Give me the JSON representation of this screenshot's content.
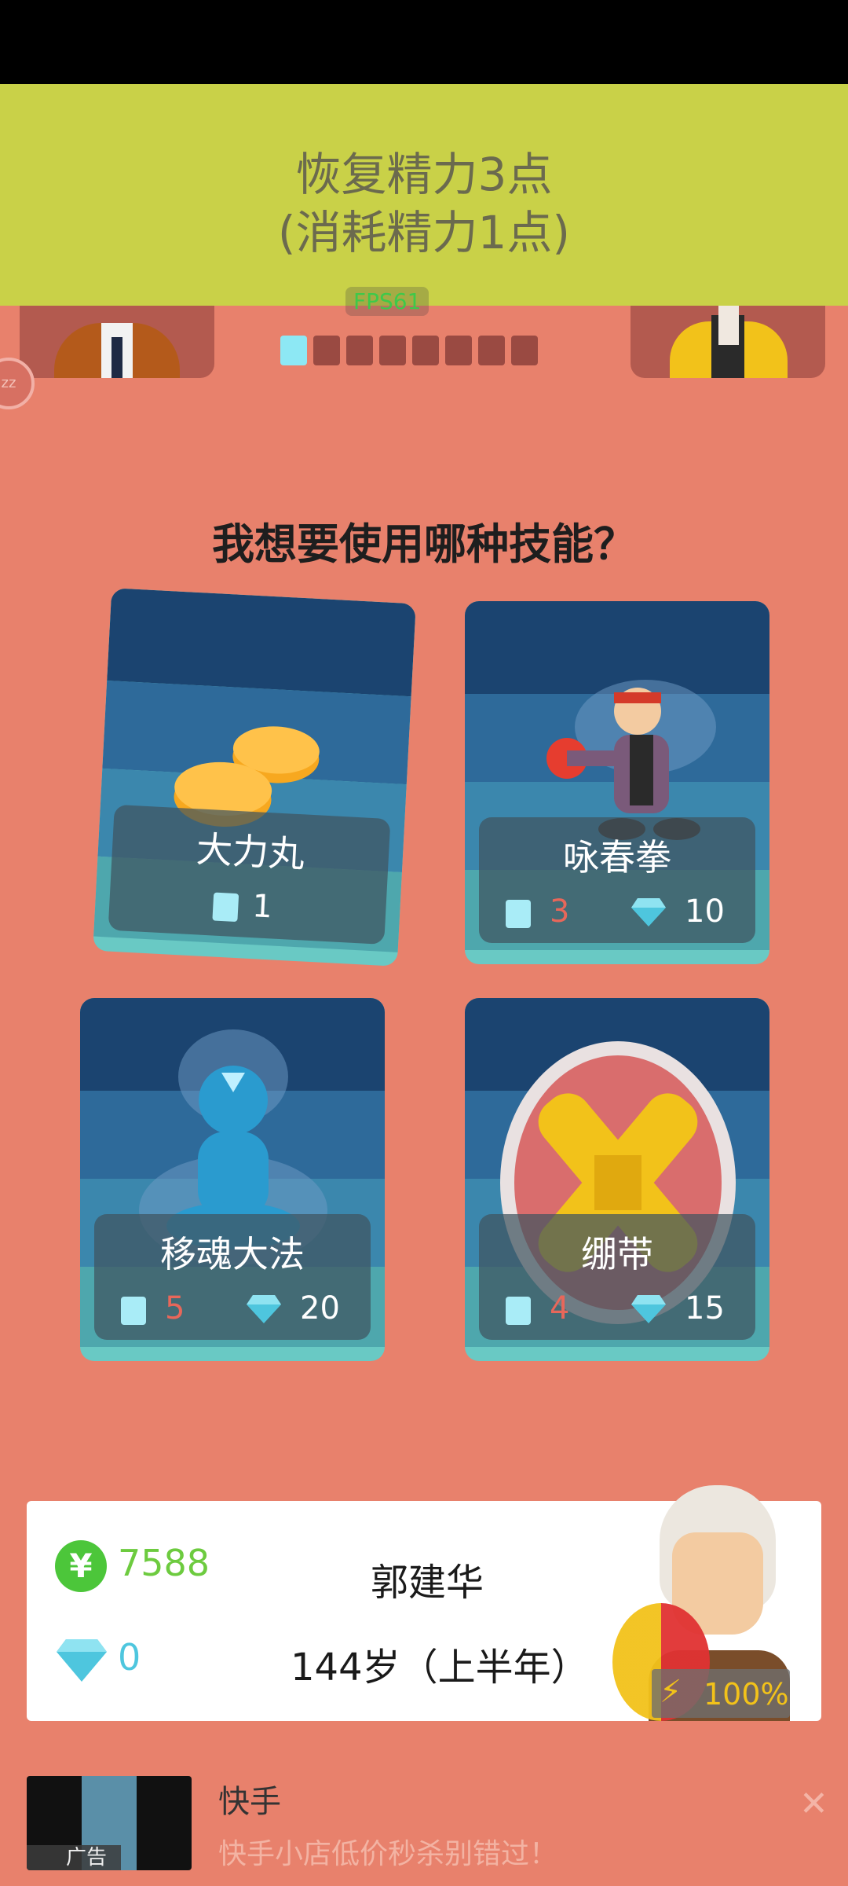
{
  "banner": {
    "line1": "恢复精力3点",
    "line2": "(消耗精力1点)",
    "fps": "FPS61"
  },
  "pager": {
    "total": 8,
    "active": 0
  },
  "side_button": {
    "label": "zz"
  },
  "question": "我想要使用哪种技能？",
  "skills": [
    {
      "name": "大力丸",
      "energy_cost": "1"
    },
    {
      "name": "咏春拳",
      "energy_cost": "3",
      "gem_cost": "10"
    },
    {
      "name": "移魂大法",
      "energy_cost": "5",
      "gem_cost": "20"
    },
    {
      "name": "绷带",
      "energy_cost": "4",
      "gem_cost": "15"
    }
  ],
  "player": {
    "money": "7588",
    "gems": "0",
    "name": "郭建华",
    "age": "144岁（上半年）",
    "energy": "100%",
    "currency_symbol": "¥"
  },
  "ad": {
    "tag": "广告",
    "title": "快手",
    "desc": "快手小店低价秒杀别错过！",
    "close": "✕"
  },
  "colors": {
    "banner": "#c9d148",
    "background": "#e8816c",
    "card_top": "#1b4470",
    "accent_cyan": "#8de8f4"
  }
}
